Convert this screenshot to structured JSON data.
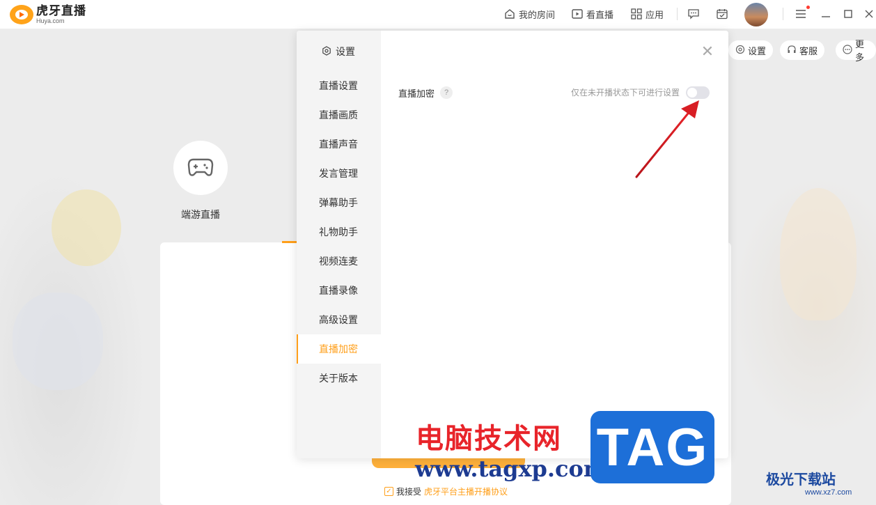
{
  "app": {
    "logo_title": "虎牙直播",
    "logo_sub": "Huya.com",
    "accent": "#ff9f1a"
  },
  "topnav": [
    {
      "label": "我的房间",
      "icon": "home-icon"
    },
    {
      "label": "看直播",
      "icon": "play-icon"
    },
    {
      "label": "应用",
      "icon": "grid-icon"
    }
  ],
  "toolbar_icons": [
    "message-icon",
    "calendar-icon",
    "menu-icon",
    "minimize-icon",
    "maximize-icon",
    "close-icon"
  ],
  "background": {
    "circle_label": "端游直播",
    "pills": [
      {
        "label": "设置",
        "icon": "gear-icon"
      },
      {
        "label": "客服",
        "icon": "headset-icon"
      },
      {
        "label": "更多",
        "icon": "more-icon"
      }
    ],
    "agree_prefix": "我接受",
    "agree_link": "虎牙平台主播开播协议"
  },
  "dialog": {
    "title": "设置",
    "menu": [
      "直播设置",
      "直播画质",
      "直播声音",
      "发言管理",
      "弹幕助手",
      "礼物助手",
      "视频连麦",
      "直播录像",
      "高级设置",
      "直播加密",
      "关于版本"
    ],
    "active_index": 9,
    "row_label": "直播加密",
    "row_help": "?",
    "row_hint": "仅在未开播状态下可进行设置",
    "toggle_on": false
  },
  "watermarks": {
    "cn": "电脑技术网",
    "url": "www.tagxp.com",
    "tag": "TAG",
    "site2": "极光下载站",
    "site2_url": "www.xz7.com"
  }
}
